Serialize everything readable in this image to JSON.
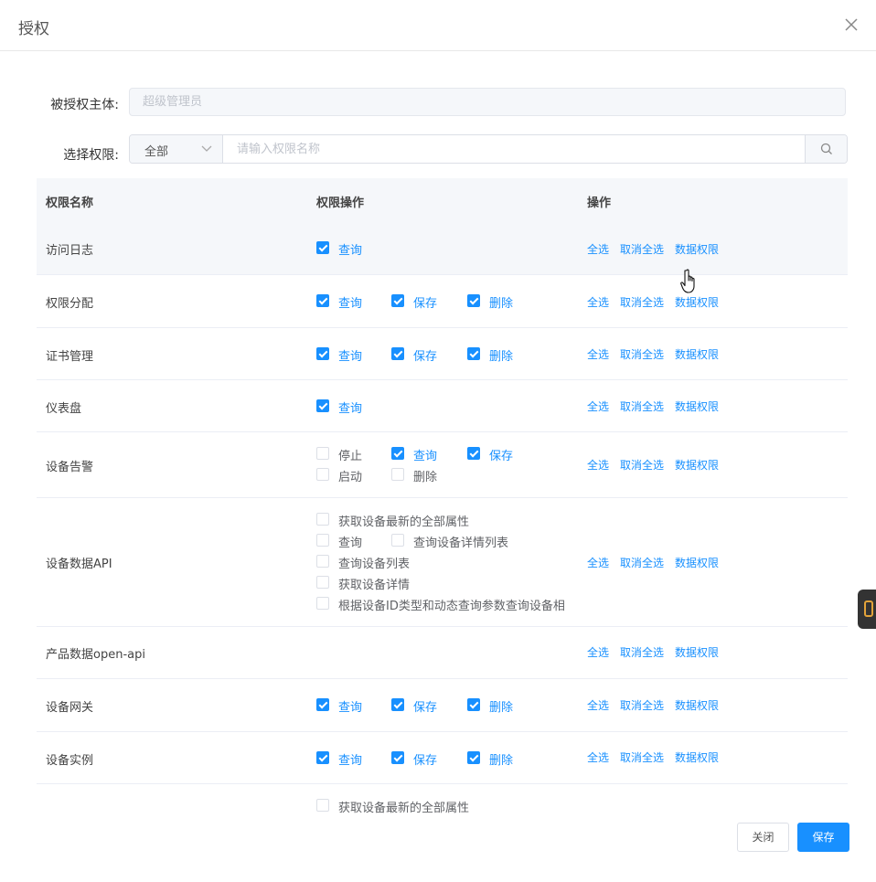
{
  "dialog": {
    "title": "授权",
    "subject_label": "被授权主体:",
    "subject_value": "超级管理员",
    "filter_label": "选择权限:",
    "filter_value": "全部",
    "search_placeholder": "请输入权限名称",
    "close_label": "关闭",
    "save_label": "保存"
  },
  "table": {
    "headers": [
      "权限名称",
      "权限操作",
      "操作"
    ],
    "ops": [
      "全选",
      "取消全选",
      "数据权限"
    ],
    "rows": [
      {
        "name": "访问日志",
        "perms": [
          {
            "label": "查询",
            "checked": true
          }
        ]
      },
      {
        "name": "权限分配",
        "perms": [
          {
            "label": "查询",
            "checked": true
          },
          {
            "label": "保存",
            "checked": true
          },
          {
            "label": "删除",
            "checked": true
          }
        ]
      },
      {
        "name": "证书管理",
        "perms": [
          {
            "label": "查询",
            "checked": true
          },
          {
            "label": "保存",
            "checked": true
          },
          {
            "label": "删除",
            "checked": true
          }
        ]
      },
      {
        "name": "仪表盘",
        "perms": [
          {
            "label": "查询",
            "checked": true
          }
        ]
      },
      {
        "name": "设备告警",
        "perms": [
          {
            "label": "停止",
            "checked": false
          },
          {
            "label": "查询",
            "checked": true
          },
          {
            "label": "保存",
            "checked": true
          },
          {
            "label": "启动",
            "checked": false
          },
          {
            "label": "删除",
            "checked": false
          }
        ]
      },
      {
        "name": "设备数据API",
        "perms": [
          {
            "label": "获取设备最新的全部属性",
            "checked": false
          },
          {
            "label": "查询",
            "checked": false
          },
          {
            "label": "查询设备详情列表",
            "checked": false
          },
          {
            "label": "查询设备列表",
            "checked": false
          },
          {
            "label": "获取设备详情",
            "checked": false
          },
          {
            "label": "根据设备ID类型和动态查询参数查询设备相",
            "checked": false
          }
        ]
      },
      {
        "name": "产品数据open-api",
        "perms": []
      },
      {
        "name": "设备网关",
        "perms": [
          {
            "label": "查询",
            "checked": true
          },
          {
            "label": "保存",
            "checked": true
          },
          {
            "label": "删除",
            "checked": true
          }
        ]
      },
      {
        "name": "设备实例",
        "perms": [
          {
            "label": "查询",
            "checked": true
          },
          {
            "label": "保存",
            "checked": true
          },
          {
            "label": "删除",
            "checked": true
          }
        ]
      },
      {
        "name": "",
        "perms": [
          {
            "label": "获取设备最新的全部属性",
            "checked": false
          }
        ]
      }
    ]
  },
  "icons": {
    "close": "close-icon",
    "search": "search-icon",
    "dropdown": "chevron-down-icon",
    "checkbox": "checkbox-icon",
    "cursor": "hand-pointer-icon",
    "side_tool": "side-tool-icon"
  },
  "colors": {
    "accent": "#1890ff",
    "header_bg": "#f5f7fa",
    "border": "#ebeef5"
  }
}
